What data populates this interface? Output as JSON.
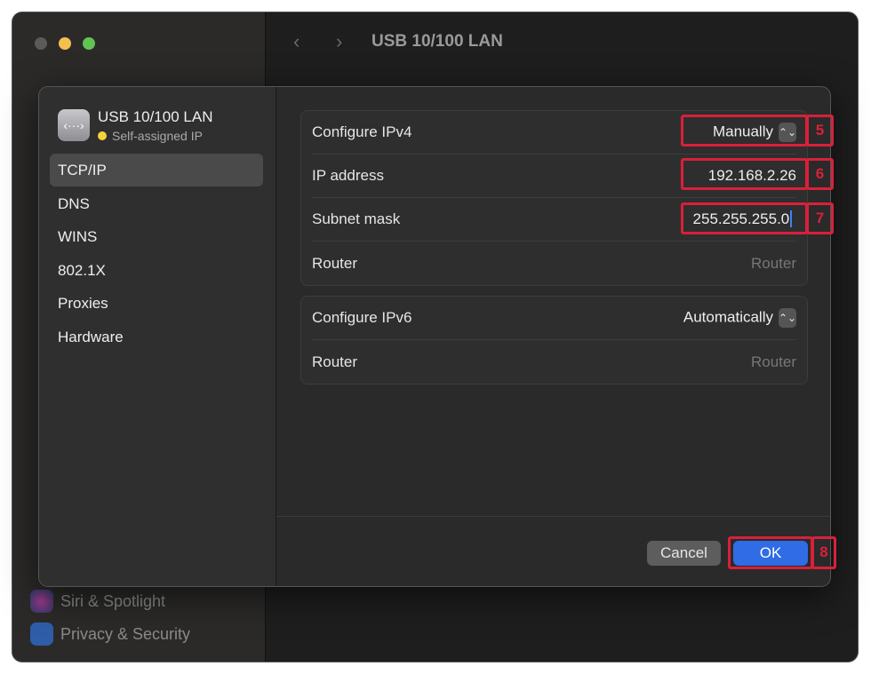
{
  "window": {
    "title": "USB 10/100 LAN"
  },
  "background_sidebar": {
    "items": [
      {
        "label": "Siri & Spotlight",
        "icon": "siri-icon"
      },
      {
        "label": "Privacy & Security",
        "icon": "hand-icon"
      }
    ]
  },
  "sheet": {
    "device": {
      "name": "USB 10/100 LAN",
      "status": "Self-assigned IP",
      "status_color": "#f5d33b",
      "icon": "ethernet-icon",
      "icon_glyph": "‹···›"
    },
    "tabs": [
      {
        "label": "TCP/IP",
        "selected": true
      },
      {
        "label": "DNS"
      },
      {
        "label": "WINS"
      },
      {
        "label": "802.1X"
      },
      {
        "label": "Proxies"
      },
      {
        "label": "Hardware"
      }
    ],
    "ipv4": {
      "configure_label": "Configure IPv4",
      "configure_value": "Manually",
      "ip_label": "IP address",
      "ip_value": "192.168.2.26",
      "subnet_label": "Subnet mask",
      "subnet_value": "255.255.255.0",
      "router_label": "Router",
      "router_placeholder": "Router"
    },
    "ipv6": {
      "configure_label": "Configure IPv6",
      "configure_value": "Automatically",
      "router_label": "Router",
      "router_placeholder": "Router"
    },
    "cancel_label": "Cancel",
    "ok_label": "OK",
    "accent": "#2f6ce5"
  },
  "annotations": [
    "5",
    "6",
    "7",
    "8"
  ]
}
